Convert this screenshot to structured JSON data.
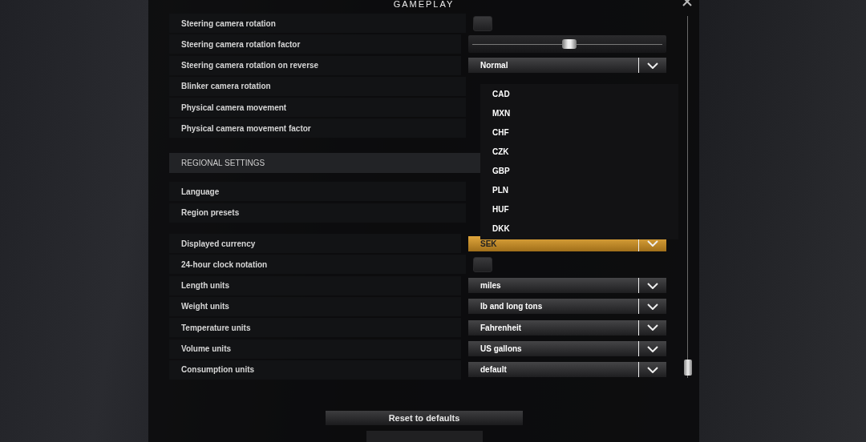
{
  "title": "GAMEPLAY",
  "sections": [
    {
      "rows": [
        {
          "label": "Steering camera rotation",
          "kind": "checkbox",
          "checked": false
        },
        {
          "label": "Steering camera rotation factor",
          "kind": "slider",
          "level": 0.51
        },
        {
          "label": "Steering camera rotation on reverse",
          "kind": "dropdown",
          "value": "Normal",
          "open": false
        },
        {
          "label": "Blinker camera rotation",
          "kind": "covered"
        },
        {
          "label": "Physical camera movement",
          "kind": "covered"
        },
        {
          "label": "Physical camera movement factor",
          "kind": "covered"
        }
      ]
    },
    {
      "header": "REGIONAL SETTINGS",
      "rows": [
        {
          "label": "Language",
          "kind": "covered"
        },
        {
          "label": "Region presets",
          "kind": "covered"
        }
      ]
    },
    {
      "rows": [
        {
          "label": "Displayed currency",
          "kind": "dropdown",
          "value": "SEK",
          "open": true
        },
        {
          "label": "24-hour clock notation",
          "kind": "checkbox",
          "checked": false
        },
        {
          "label": "Length units",
          "kind": "dropdown",
          "value": "miles",
          "open": false
        },
        {
          "label": "Weight units",
          "kind": "dropdown",
          "value": "lb and long tons",
          "open": false
        },
        {
          "label": "Temperature units",
          "kind": "dropdown",
          "value": "Fahrenheit",
          "open": false
        },
        {
          "label": "Volume units",
          "kind": "dropdown",
          "value": "US gallons",
          "open": false
        },
        {
          "label": "Consumption units",
          "kind": "dropdown",
          "value": "default",
          "open": false
        }
      ]
    }
  ],
  "currency_list": [
    "CAD",
    "MXN",
    "CHF",
    "CZK",
    "GBP",
    "PLN",
    "HUF",
    "DKK"
  ],
  "reset_button": "Reset to defaults"
}
